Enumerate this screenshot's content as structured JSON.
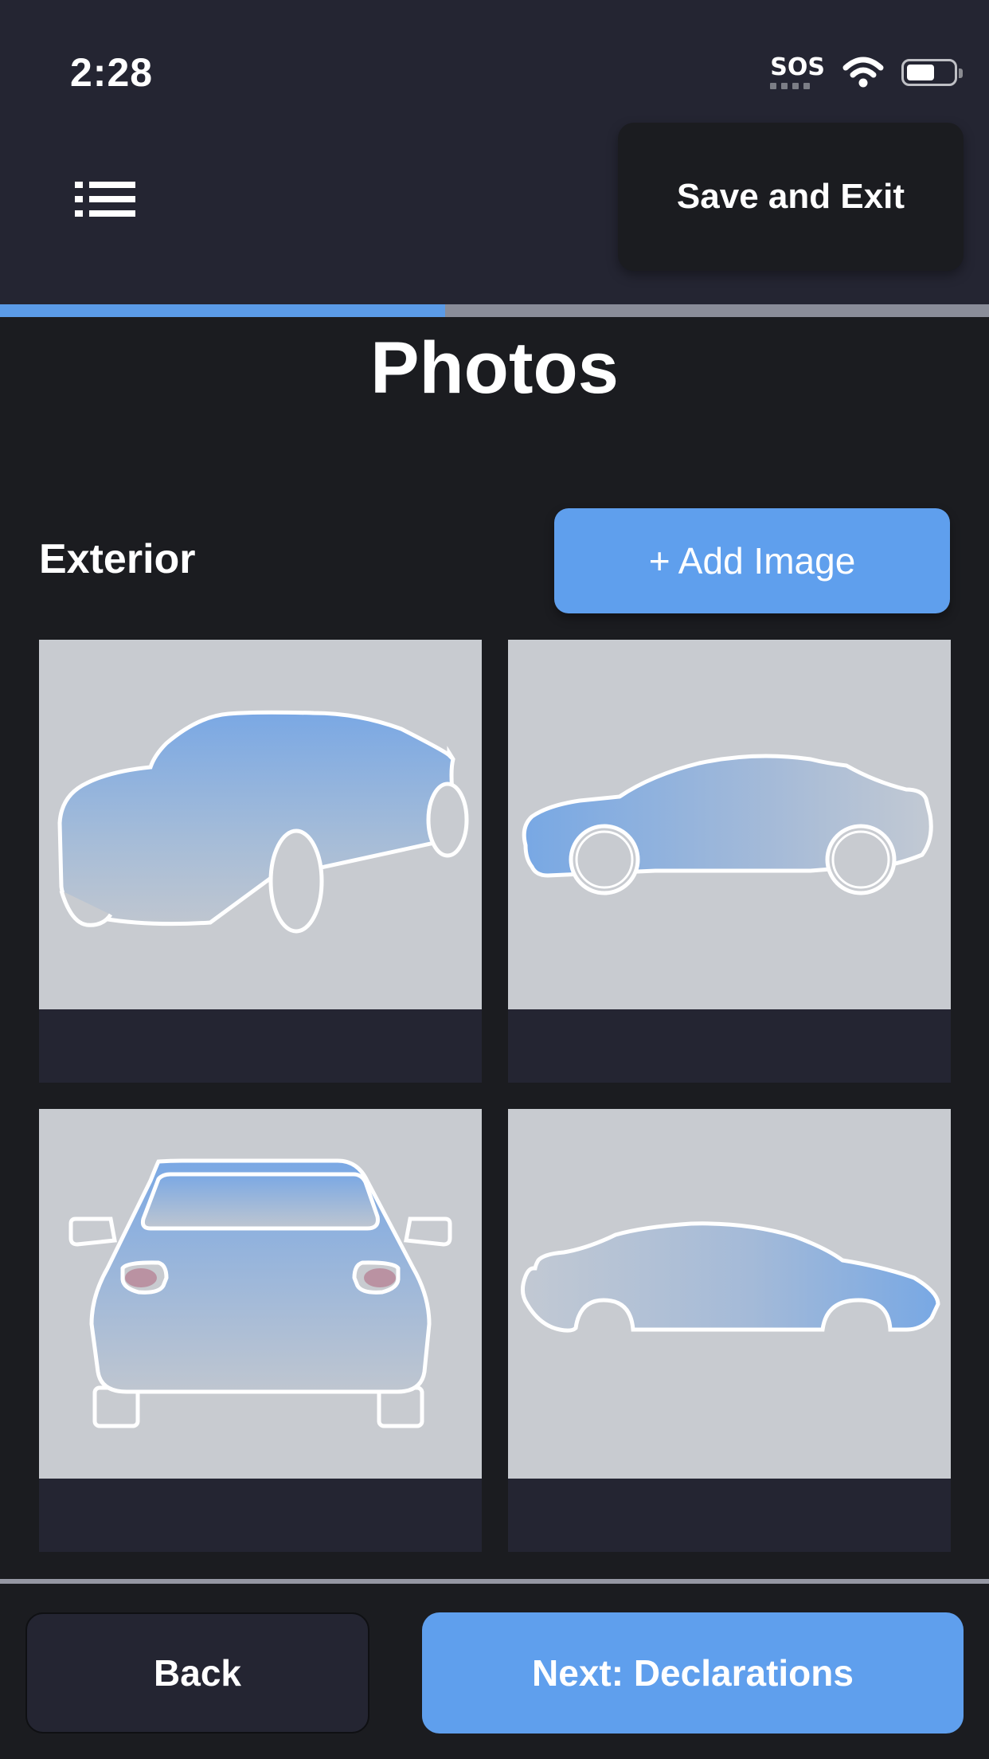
{
  "status_bar": {
    "time": "2:28",
    "sos": "SOS",
    "battery_level": 0.65
  },
  "header": {
    "save_exit_label": "Save and Exit"
  },
  "progress": {
    "fraction": 0.45
  },
  "page": {
    "title": "Photos"
  },
  "section": {
    "label": "Exterior",
    "add_image_label": "+ Add Image"
  },
  "tiles": [
    {
      "view": "front-three-quarter-car-placeholder"
    },
    {
      "view": "side-car-placeholder"
    },
    {
      "view": "rear-car-placeholder"
    },
    {
      "view": "side-body-car-placeholder"
    }
  ],
  "footer": {
    "back_label": "Back",
    "next_label": "Next: Declarations"
  },
  "colors": {
    "accent": "#5f9fed",
    "background": "#1b1c20",
    "header": "#242532",
    "tile_placeholder": "#c8cbd0"
  }
}
